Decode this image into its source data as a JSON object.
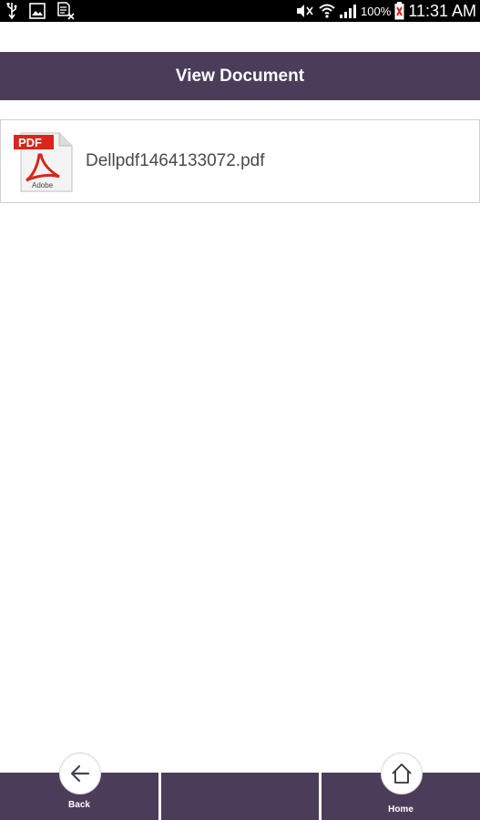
{
  "status_bar": {
    "battery": "100%",
    "time": "11:31 AM"
  },
  "header": {
    "title": "View Document"
  },
  "documents": [
    {
      "name": "Dellpdf1464133072.pdf",
      "icon": "pdf-icon",
      "icon_label": "PDF"
    }
  ],
  "bottom_nav": {
    "back_label": "Back",
    "home_label": "Home"
  },
  "colors": {
    "bar": "#4b3d5a",
    "pdf_red": "#d8261c"
  }
}
